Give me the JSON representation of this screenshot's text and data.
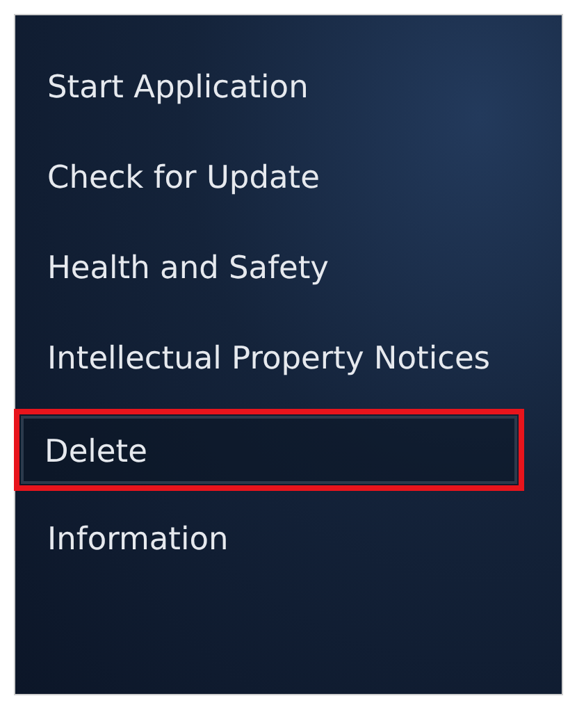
{
  "menu": {
    "items": [
      {
        "label": "Start Application",
        "selected": false
      },
      {
        "label": "Check for Update",
        "selected": false
      },
      {
        "label": "Health and Safety",
        "selected": false
      },
      {
        "label": "Intellectual Property Notices",
        "selected": false
      },
      {
        "label": "Delete",
        "selected": true
      },
      {
        "label": "Information",
        "selected": false
      }
    ]
  }
}
